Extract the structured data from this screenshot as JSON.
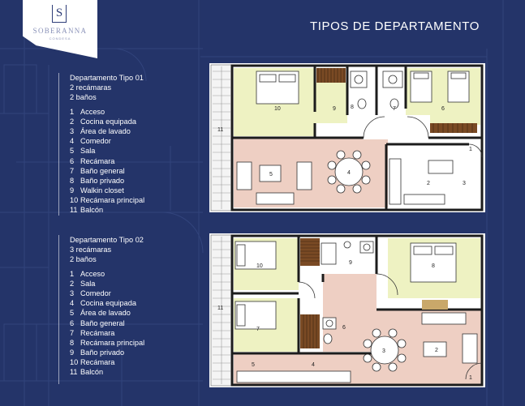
{
  "logo": {
    "mark": "S",
    "name": "SOBERANNA",
    "sub": "CONDESA"
  },
  "title": "TIPOS DE DEPARTAMENTO",
  "units": [
    {
      "heading": "Departamento Tipo 01",
      "summary": [
        "2 recámaras",
        "2 baños"
      ],
      "rooms": [
        {
          "n": "1",
          "label": "Acceso"
        },
        {
          "n": "2",
          "label": "Cocina equipada"
        },
        {
          "n": "3",
          "label": "Área de lavado"
        },
        {
          "n": "4",
          "label": "Comedor"
        },
        {
          "n": "5",
          "label": "Sala"
        },
        {
          "n": "6",
          "label": "Recámara"
        },
        {
          "n": "7",
          "label": "Baño general"
        },
        {
          "n": "8",
          "label": "Baño privado"
        },
        {
          "n": "9",
          "label": "Walkin closet"
        },
        {
          "n": "10",
          "label": "Recámara principal"
        },
        {
          "n": "11",
          "label": "Balcón"
        }
      ]
    },
    {
      "heading": "Departamento Tipo 02",
      "summary": [
        "3 recámaras",
        "2 baños"
      ],
      "rooms": [
        {
          "n": "1",
          "label": "Acceso"
        },
        {
          "n": "2",
          "label": "Sala"
        },
        {
          "n": "3",
          "label": "Comedor"
        },
        {
          "n": "4",
          "label": "Cocina equipada"
        },
        {
          "n": "5",
          "label": "Área de lavado"
        },
        {
          "n": "6",
          "label": "Baño general"
        },
        {
          "n": "7",
          "label": "Recámara"
        },
        {
          "n": "8",
          "label": "Recámara principal"
        },
        {
          "n": "9",
          "label": "Baño privado"
        },
        {
          "n": "10",
          "label": "Recámara"
        },
        {
          "n": "11",
          "label": "Balcón"
        }
      ]
    }
  ],
  "plan_labels": {
    "p1": [
      "1",
      "2",
      "3",
      "4",
      "5",
      "6",
      "7",
      "8",
      "9",
      "10",
      "11"
    ],
    "p2": [
      "1",
      "2",
      "3",
      "4",
      "5",
      "6",
      "7",
      "8",
      "9",
      "10",
      "11"
    ]
  },
  "colors": {
    "background": "#243469",
    "bedroom": "#eef2c2",
    "living": "#eecfc3",
    "bath": "#ffffff",
    "wall": "#1c1c1c",
    "wood": "#7a4a24"
  }
}
